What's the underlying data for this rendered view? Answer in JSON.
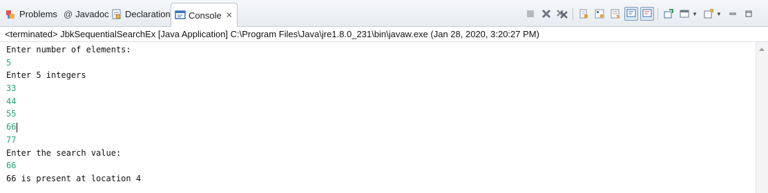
{
  "tabs": [
    {
      "label": "Problems",
      "icon": "problems-icon"
    },
    {
      "label": "Javadoc",
      "icon": "javadoc-icon"
    },
    {
      "label": "Declaration",
      "icon": "declaration-icon"
    },
    {
      "label": "Console",
      "icon": "console-icon",
      "active": true
    }
  ],
  "toolbar": {
    "buttons": [
      "terminate-icon",
      "remove-launch-icon",
      "remove-all-terminated-icon",
      "clear-console-icon",
      "scroll-lock-icon",
      "word-wrap-icon",
      "show-on-stdout-icon",
      "show-on-stderr-icon",
      "pin-console-icon",
      "display-console-icon",
      "open-console-icon",
      "minimize-icon",
      "maximize-icon"
    ]
  },
  "status": {
    "text": "<terminated> JbkSequentialSearchEx [Java Application] C:\\Program Files\\Java\\jre1.8.0_231\\bin\\javaw.exe (Jan 28, 2020, 3:20:27 PM)"
  },
  "console": {
    "lines": [
      {
        "text": "Enter number of elements:",
        "type": "out"
      },
      {
        "text": "5",
        "type": "in"
      },
      {
        "text": "Enter 5 integers",
        "type": "out"
      },
      {
        "text": "33",
        "type": "in"
      },
      {
        "text": "44",
        "type": "in"
      },
      {
        "text": "55",
        "type": "in"
      },
      {
        "text": "66",
        "type": "in"
      },
      {
        "text": "77",
        "type": "in"
      },
      {
        "text": "Enter the search value:",
        "type": "out"
      },
      {
        "text": "66",
        "type": "in"
      },
      {
        "text": "66 is present at location 4",
        "type": "out"
      }
    ]
  },
  "colors": {
    "stdout": "#111111",
    "stdin": "#1fa572",
    "tab_active_border": "#b8c3d1"
  }
}
